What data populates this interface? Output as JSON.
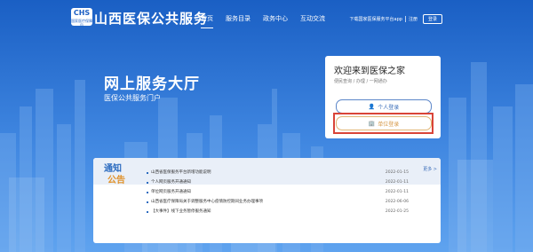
{
  "header": {
    "logo_text": "CHS",
    "logo_sub": "国家医疗保障局",
    "site_title": "山西医保公共服务",
    "nav": [
      "首页",
      "服务目录",
      "政务中心",
      "互动交流"
    ],
    "download_app": "下载国家医保服务平台app",
    "register": "注册",
    "login": "登录"
  },
  "hero": {
    "title": "网上服务大厅",
    "subtitle": "医保公共服务门户"
  },
  "login_card": {
    "welcome": "欢迎来到医保之家",
    "subtitle": "便民查询 / 办理 / 一网通办",
    "personal_login": "个人登录",
    "unit_login": "单位登录"
  },
  "notice": {
    "tag_line1": "通知",
    "tag_line2": "公告",
    "more": "更多 >",
    "items": [
      {
        "title": "山西省医保服务平台新增功能说明",
        "date": "2022-01-15"
      },
      {
        "title": "个人网页服务开通通知",
        "date": "2022-01-11"
      },
      {
        "title": "单位网页服务开通通知",
        "date": "2022-01-11"
      },
      {
        "title": "山西省医疗保障局关于调整服务中心疫情防控期间业务办理事项",
        "date": "2022-06-06"
      },
      {
        "title": "【大事件】线下业务暂停服务通知",
        "date": "2022-01-25"
      }
    ]
  },
  "colors": {
    "background": "#1c63c8",
    "highlight": "#d94438",
    "accent_blue": "#2d6cc0",
    "accent_orange": "#e0922c"
  }
}
